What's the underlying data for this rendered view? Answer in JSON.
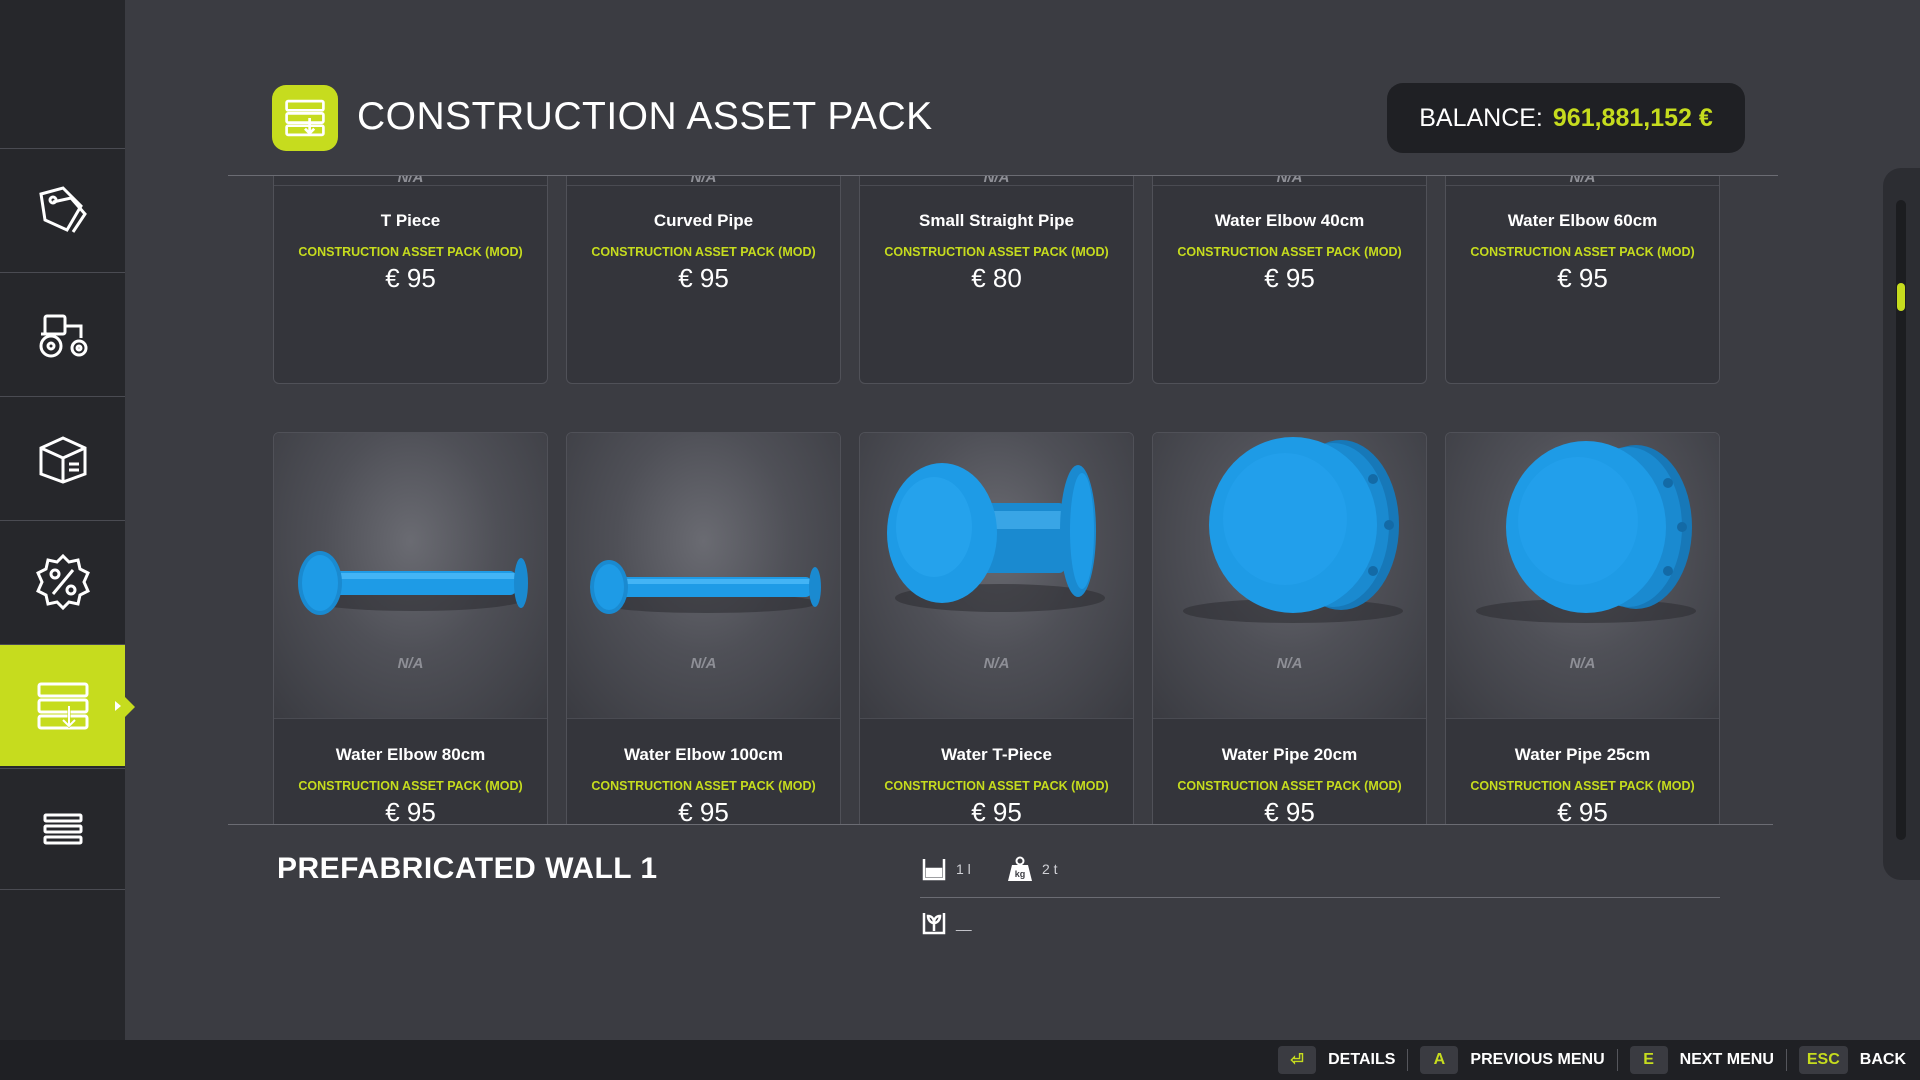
{
  "header": {
    "title": "CONSTRUCTION ASSET PACK",
    "balance_label": "BALANCE:",
    "balance_value": "961,881,152 €"
  },
  "sidebar": {
    "items": [
      {
        "name": "tag-icon"
      },
      {
        "name": "tractor-icon"
      },
      {
        "name": "box-icon"
      },
      {
        "name": "percent-badge-icon"
      },
      {
        "name": "asset-pack-icon",
        "active": true
      },
      {
        "name": "list-icon"
      }
    ]
  },
  "top_row": [
    {
      "na": "N/A",
      "name": "T Piece",
      "pack": "CONSTRUCTION ASSET PACK (MOD)",
      "price": "€ 95"
    },
    {
      "na": "N/A",
      "name": "Curved Pipe",
      "pack": "CONSTRUCTION ASSET PACK (MOD)",
      "price": "€ 95"
    },
    {
      "na": "N/A",
      "name": "Small Straight Pipe",
      "pack": "CONSTRUCTION ASSET PACK (MOD)",
      "price": "€ 80"
    },
    {
      "na": "N/A",
      "name": "Water Elbow 40cm",
      "pack": "CONSTRUCTION ASSET PACK (MOD)",
      "price": "€ 95"
    },
    {
      "na": "N/A",
      "name": "Water Elbow 60cm",
      "pack": "CONSTRUCTION ASSET PACK (MOD)",
      "price": "€ 95"
    }
  ],
  "bottom_row": [
    {
      "na": "N/A",
      "name": "Water Elbow 80cm",
      "pack": "CONSTRUCTION ASSET PACK (MOD)",
      "price": "€ 95",
      "image": "long-pipe"
    },
    {
      "na": "N/A",
      "name": "Water Elbow 100cm",
      "pack": "CONSTRUCTION ASSET PACK (MOD)",
      "price": "€ 95",
      "image": "long-pipe"
    },
    {
      "na": "N/A",
      "name": "Water T-Piece",
      "pack": "CONSTRUCTION ASSET PACK (MOD)",
      "price": "€ 95",
      "image": "t-piece"
    },
    {
      "na": "N/A",
      "name": "Water Pipe 20cm",
      "pack": "CONSTRUCTION ASSET PACK (MOD)",
      "price": "€ 95",
      "image": "disc-pipe"
    },
    {
      "na": "N/A",
      "name": "Water Pipe 25cm",
      "pack": "CONSTRUCTION ASSET PACK (MOD)",
      "price": "€ 95",
      "image": "disc-pipe"
    }
  ],
  "detail": {
    "title": "PREFABRICATED WALL 1",
    "capacity": "1 l",
    "weight": "2 t",
    "fill_type": "__"
  },
  "footer": {
    "hints": [
      {
        "key": "⏎",
        "label": "DETAILS"
      },
      {
        "key": "A",
        "label": "PREVIOUS MENU"
      },
      {
        "key": "E",
        "label": "NEXT MENU"
      },
      {
        "key": "ESC",
        "label": "BACK"
      }
    ]
  },
  "colors": {
    "accent": "#c6dc1e",
    "pipe": "#1e9be6",
    "background": "#3b3c42",
    "sidebar": "#26272b"
  }
}
